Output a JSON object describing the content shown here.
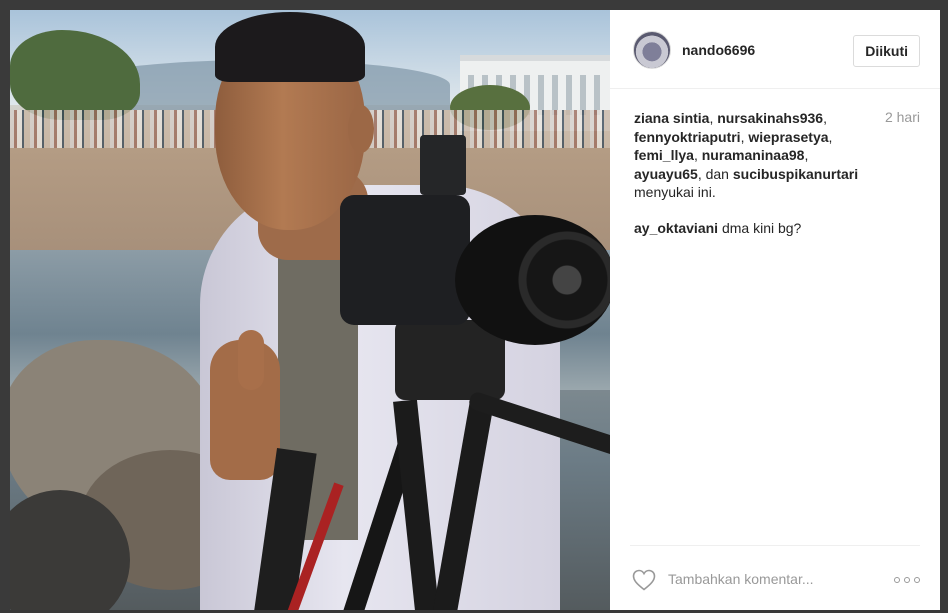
{
  "post": {
    "username": "nando6696",
    "follow_label": "Diikuti",
    "time_ago": "2 hari",
    "likers": [
      "ziana sintia",
      "nursakinahs936",
      "fennyoktriaputri",
      "wieprasetya",
      "femi_llya",
      "nuramaninaa98",
      "ayuayu65"
    ],
    "last_liker": "sucibuspikanurtari",
    "and_word": "dan",
    "likes_suffix": "menyukai ini.",
    "comment": {
      "user": "ay_oktaviani",
      "text": "dma kini bg?"
    },
    "add_comment_placeholder": "Tambahkan komentar...",
    "icons": {
      "like": "heart-icon",
      "more": "more-options-icon"
    }
  }
}
